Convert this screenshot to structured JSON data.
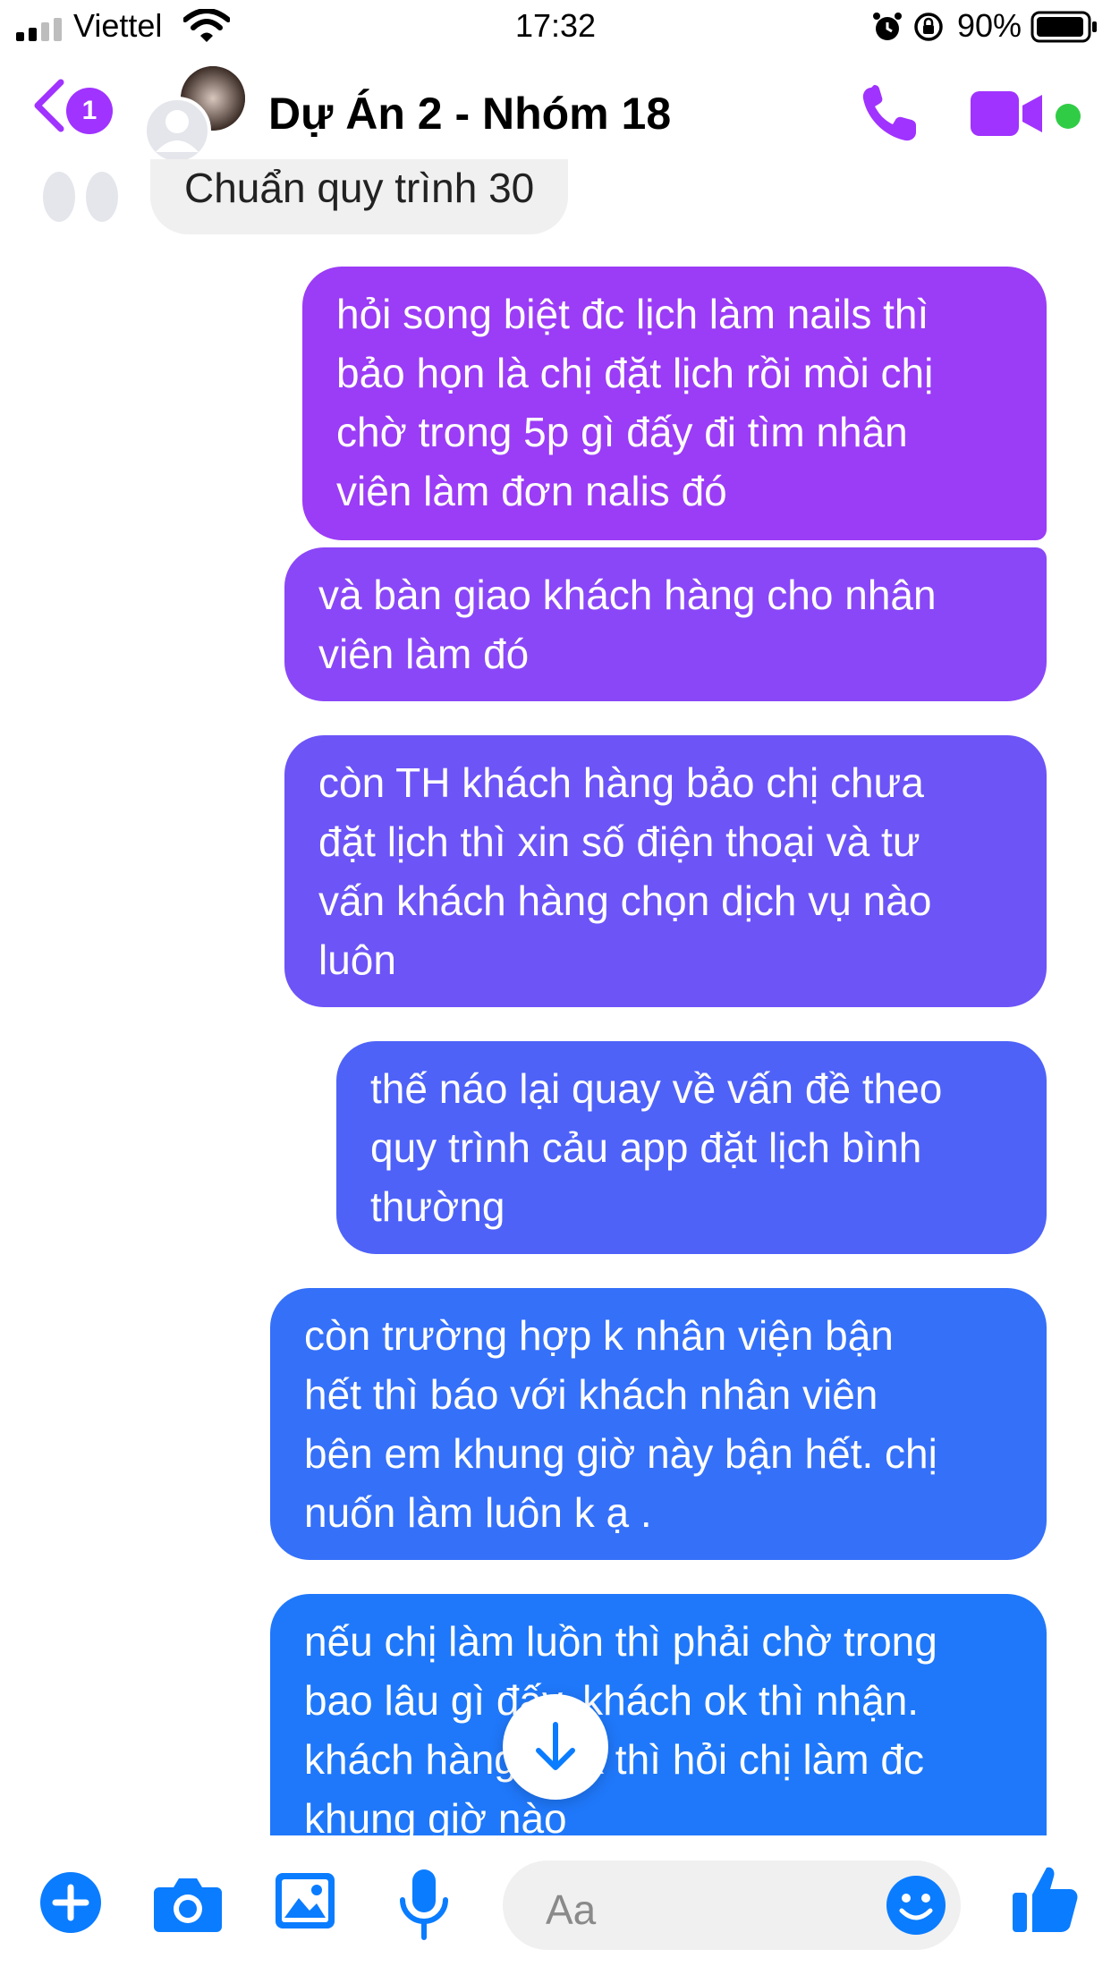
{
  "status_bar": {
    "carrier": "Viettel",
    "time": "17:32",
    "battery": "90%"
  },
  "header": {
    "unread_count": "1",
    "title": "Dự Án 2 - Nhóm 18"
  },
  "messages": {
    "received": "Chuẩn quy trình 30",
    "sent": [
      "hỏi song biệt đc lịch làm nails thì\nbảo họn là chị đặt lịch rồi mòi chị\nchờ trong 5p gì đấy đi  tìm nhân\nviên làm đơn nalis đó",
      "và bàn giao khách hàng cho nhân\nviên làm đó",
      "còn TH khách hàng bảo chị chưa\nđặt lịch thì xin số điện thoại và tư\nvấn khách hàng chọn dịch vụ nào\nluôn",
      "thế náo lại quay về vấn đề theo\nquy trình cảu app đặt lịch bình\nthường",
      "còn trường hợp k nhân viện bận\nhết thì báo với khách nhân viên\nbên em khung giờ này bận hết. chị\nnuốn làm luôn k ạ .",
      "nếu chị làm luồn thì phải chờ trong\nbao lâu gì đấy. khách ok thì nhận.\nkhách hàng k ok thì hỏi chị làm đc\nkhung giờ nào"
    ]
  },
  "composer": {
    "placeholder": "Aa"
  },
  "colors": {
    "accent_purple": "#a033ff",
    "accent_blue": "#0a7cff",
    "online": "#31cc46"
  },
  "icons": [
    "signal-icon",
    "wifi-icon",
    "alarm-icon",
    "rotation-lock-icon",
    "battery-icon",
    "back-chevron-icon",
    "phone-icon",
    "video-camera-icon",
    "plus-icon",
    "camera-icon",
    "image-icon",
    "microphone-icon",
    "emoji-icon",
    "thumbs-up-icon",
    "arrow-down-icon"
  ]
}
